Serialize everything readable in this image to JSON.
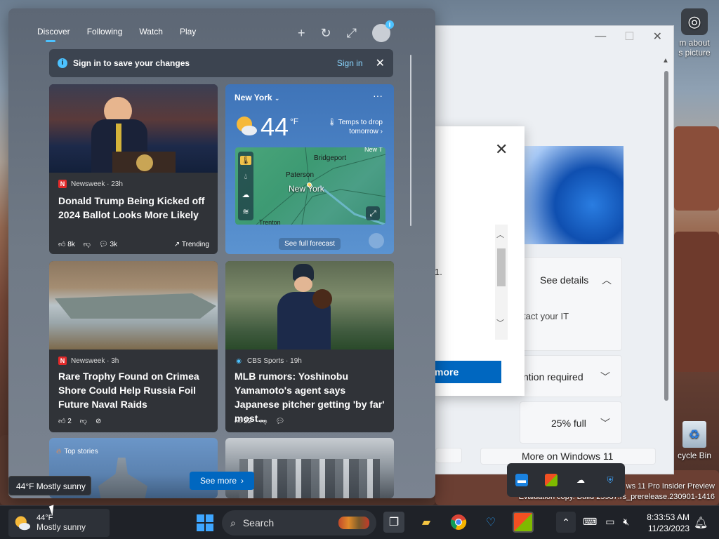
{
  "desktop": {
    "icon_top_label_1": "m about",
    "icon_top_label_2": "s picture",
    "recycle_label": "cycle Bin",
    "watermark_line1": "ws 11 Pro Insider Preview",
    "watermark_line2": "Evaluation copy. Build 25987.rs_prerelease.230901-1416"
  },
  "settings_window": {
    "minimize": "—",
    "maximize": "☐",
    "close": "✕",
    "see_details": "See details",
    "contact_it": "tact your IT",
    "attention": "ntion required",
    "storage": "25% full",
    "more_windows": "More on Windows 11"
  },
  "dialog": {
    "close": "✕",
    "fragment": "1.",
    "button": "more"
  },
  "widgets": {
    "tabs": [
      {
        "label": "Discover"
      },
      {
        "label": "Following"
      },
      {
        "label": "Watch"
      },
      {
        "label": "Play"
      }
    ],
    "tools": {
      "add": "+",
      "refresh": "↻",
      "expand": "⤢"
    },
    "signin_bar": {
      "message": "Sign in to save your changes",
      "link": "Sign in",
      "close": "✕"
    },
    "news": [
      {
        "source": "Newsweek · 23h",
        "logo": "N",
        "headline": "Donald Trump Being Kicked off 2024 Ballot Looks More Likely",
        "likes": "8k",
        "comments": "3k",
        "trending": "Trending"
      },
      {
        "source": "Newsweek · 3h",
        "logo": "N",
        "headline": "Rare Trophy Found on Crimea Shore Could Help Russia Foil Future Naval Raids",
        "likes": "2"
      },
      {
        "source": "CBS Sports · 19h",
        "logo": "◉",
        "headline": "MLB rumors: Yoshinobu Yamamoto's agent says Japanese pitcher getting 'by far' most...",
        "likes": "22"
      }
    ],
    "weather": {
      "location": "New York",
      "temp": "44",
      "unit": "°F",
      "note": "Temps to drop tomorrow",
      "cities": {
        "bridgeport": "Bridgeport",
        "paterson": "Paterson",
        "newyork": "New York",
        "trenton": "Trenton",
        "newt": "New T"
      },
      "footer": "See full forecast"
    },
    "top_stories": "Top stories",
    "see_more": "See more"
  },
  "tooltip": "44°F Mostly sunny",
  "taskbar": {
    "weather_temp": "44°F",
    "weather_cond": "Mostly sunny",
    "search": "Search",
    "time": "8:33:53 AM",
    "date": "11/23/2023"
  },
  "colors": {
    "accent": "#0067c0",
    "tab_indicator": "#4cc2ff",
    "link": "#8ad6ff"
  }
}
